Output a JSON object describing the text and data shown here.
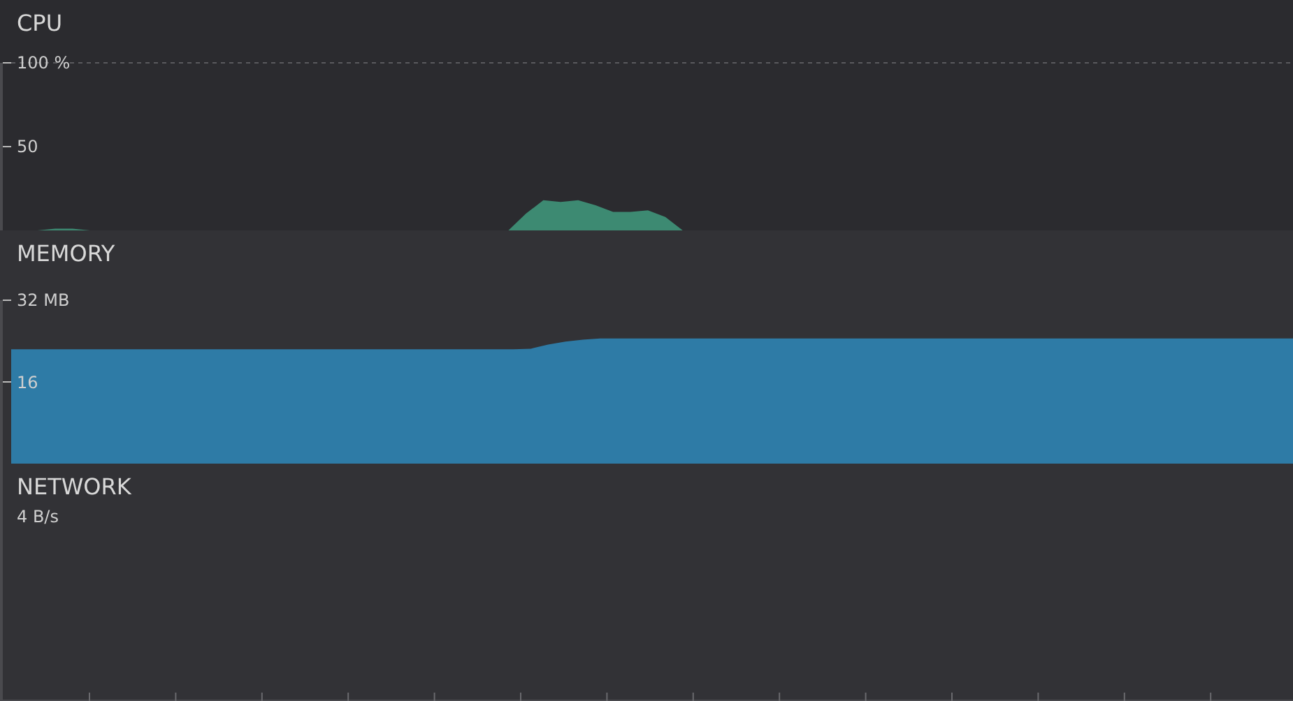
{
  "panels": [
    {
      "kind": "cpu",
      "title": "CPU",
      "chart_data": {
        "type": "area",
        "ylim": [
          0,
          100
        ],
        "yticks": [
          {
            "value": 100,
            "label": "100 %"
          },
          {
            "value": 50,
            "label": "50"
          }
        ],
        "series": [
          {
            "color": "#3d8a72",
            "values": [
              0,
              0,
              0,
              1,
              1,
              0,
              0,
              0,
              0,
              0,
              0,
              0,
              0,
              0,
              0,
              0,
              0,
              0,
              0,
              0,
              0,
              0,
              0,
              0,
              0,
              0,
              0,
              0,
              0,
              0,
              10,
              18,
              17,
              18,
              15,
              11,
              11,
              12,
              8,
              0,
              0,
              0,
              0,
              0,
              0,
              0,
              0,
              0,
              0,
              0,
              0,
              0,
              0,
              0,
              0,
              0,
              0,
              0,
              0,
              0,
              0,
              0,
              0,
              0,
              0,
              0,
              0,
              0,
              0,
              0,
              0,
              0,
              0,
              0,
              0
            ]
          }
        ]
      }
    },
    {
      "kind": "memory",
      "title": "MEMORY",
      "chart_data": {
        "type": "area",
        "ylim": [
          0,
          32
        ],
        "yticks": [
          {
            "value": 32,
            "label": "32 MB"
          },
          {
            "value": 16,
            "label": "16"
          }
        ],
        "series": [
          {
            "color": "#2e7ba6",
            "values": [
              22.4,
              22.4,
              22.4,
              22.4,
              22.4,
              22.4,
              22.4,
              22.4,
              22.4,
              22.4,
              22.4,
              22.4,
              22.4,
              22.4,
              22.4,
              22.4,
              22.4,
              22.4,
              22.4,
              22.4,
              22.4,
              22.4,
              22.4,
              22.4,
              22.4,
              22.4,
              22.4,
              22.4,
              22.4,
              22.4,
              22.5,
              23.3,
              23.9,
              24.3,
              24.5,
              24.5,
              24.5,
              24.5,
              24.5,
              24.5,
              24.5,
              24.5,
              24.5,
              24.5,
              24.5,
              24.5,
              24.5,
              24.5,
              24.5,
              24.5,
              24.5,
              24.5,
              24.5,
              24.5,
              24.5,
              24.5,
              24.5,
              24.5,
              24.5,
              24.5,
              24.5,
              24.5,
              24.5,
              24.5,
              24.5,
              24.5,
              24.5,
              24.5,
              24.5,
              24.5,
              24.5,
              24.5,
              24.5,
              24.5,
              24.5
            ]
          }
        ]
      }
    },
    {
      "kind": "network",
      "title": "NETWORK",
      "scale_label": "4 B/s"
    }
  ]
}
